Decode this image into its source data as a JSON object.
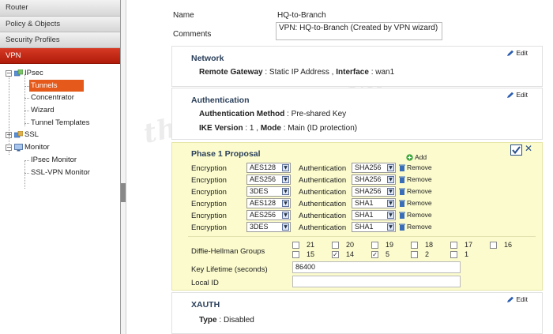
{
  "sidebar": {
    "top_items": [
      {
        "label": "Router"
      },
      {
        "label": "Policy & Objects"
      },
      {
        "label": "Security Profiles"
      },
      {
        "label": "VPN"
      }
    ],
    "tree": {
      "ipsec": "IPsec",
      "tunnels": "Tunnels",
      "concentrator": "Concentrator",
      "wizard": "Wizard",
      "tunnel_templates": "Tunnel Templates",
      "ssl": "SSL",
      "monitor": "Monitor",
      "ipsec_monitor": "IPsec Monitor",
      "sslvpn_monitor": "SSL-VPN Monitor"
    }
  },
  "form": {
    "name_label": "Name",
    "name_value": "HQ-to-Branch",
    "comments_label": "Comments",
    "comments_value": "VPN: HQ-to-Branch (Created by VPN wizard)"
  },
  "edit_label": "Edit",
  "network": {
    "title": "Network",
    "gateway_label": "Remote Gateway",
    "gateway_value": ": Static IP Address ,",
    "interface_label": "Interface",
    "interface_value": ": wan1"
  },
  "authentication": {
    "title": "Authentication",
    "method_label": "Authentication Method",
    "method_value": ": Pre-shared Key",
    "ike_label": "IKE Version",
    "ike_value": ": 1 ,",
    "mode_label": "Mode",
    "mode_value": ": Main (ID protection)"
  },
  "phase1": {
    "title": "Phase 1 Proposal",
    "add_label": "Add",
    "encryption_label": "Encryption",
    "authentication_label": "Authentication",
    "remove_label": "Remove",
    "proposals": [
      {
        "encryption": "AES128",
        "authentication": "SHA256"
      },
      {
        "encryption": "AES256",
        "authentication": "SHA256"
      },
      {
        "encryption": "3DES",
        "authentication": "SHA256"
      },
      {
        "encryption": "AES128",
        "authentication": "SHA1"
      },
      {
        "encryption": "AES256",
        "authentication": "SHA1"
      },
      {
        "encryption": "3DES",
        "authentication": "SHA1"
      }
    ],
    "dh_label": "Diffie-Hellman Groups",
    "dh_groups": [
      {
        "num": "21",
        "checked": false
      },
      {
        "num": "20",
        "checked": false
      },
      {
        "num": "19",
        "checked": false
      },
      {
        "num": "18",
        "checked": false
      },
      {
        "num": "17",
        "checked": false
      },
      {
        "num": "16",
        "checked": false
      },
      {
        "num": "15",
        "checked": false
      },
      {
        "num": "14",
        "checked": true
      },
      {
        "num": "5",
        "checked": true
      },
      {
        "num": "2",
        "checked": false
      },
      {
        "num": "1",
        "checked": false
      }
    ],
    "key_lifetime_label": "Key Lifetime (seconds)",
    "key_lifetime_value": "86400",
    "local_id_label": "Local ID",
    "local_id_value": ""
  },
  "xauth": {
    "title": "XAUTH",
    "type_label": "Type",
    "type_value": ": Disabled"
  },
  "watermark": "thegioimang.vn",
  "colors": {
    "vpn_header": "#c0250f",
    "selected_tree_item": "#e55a1a",
    "panel_title": "#2a3f5a",
    "phase1_bg": "#fbfbcd"
  }
}
